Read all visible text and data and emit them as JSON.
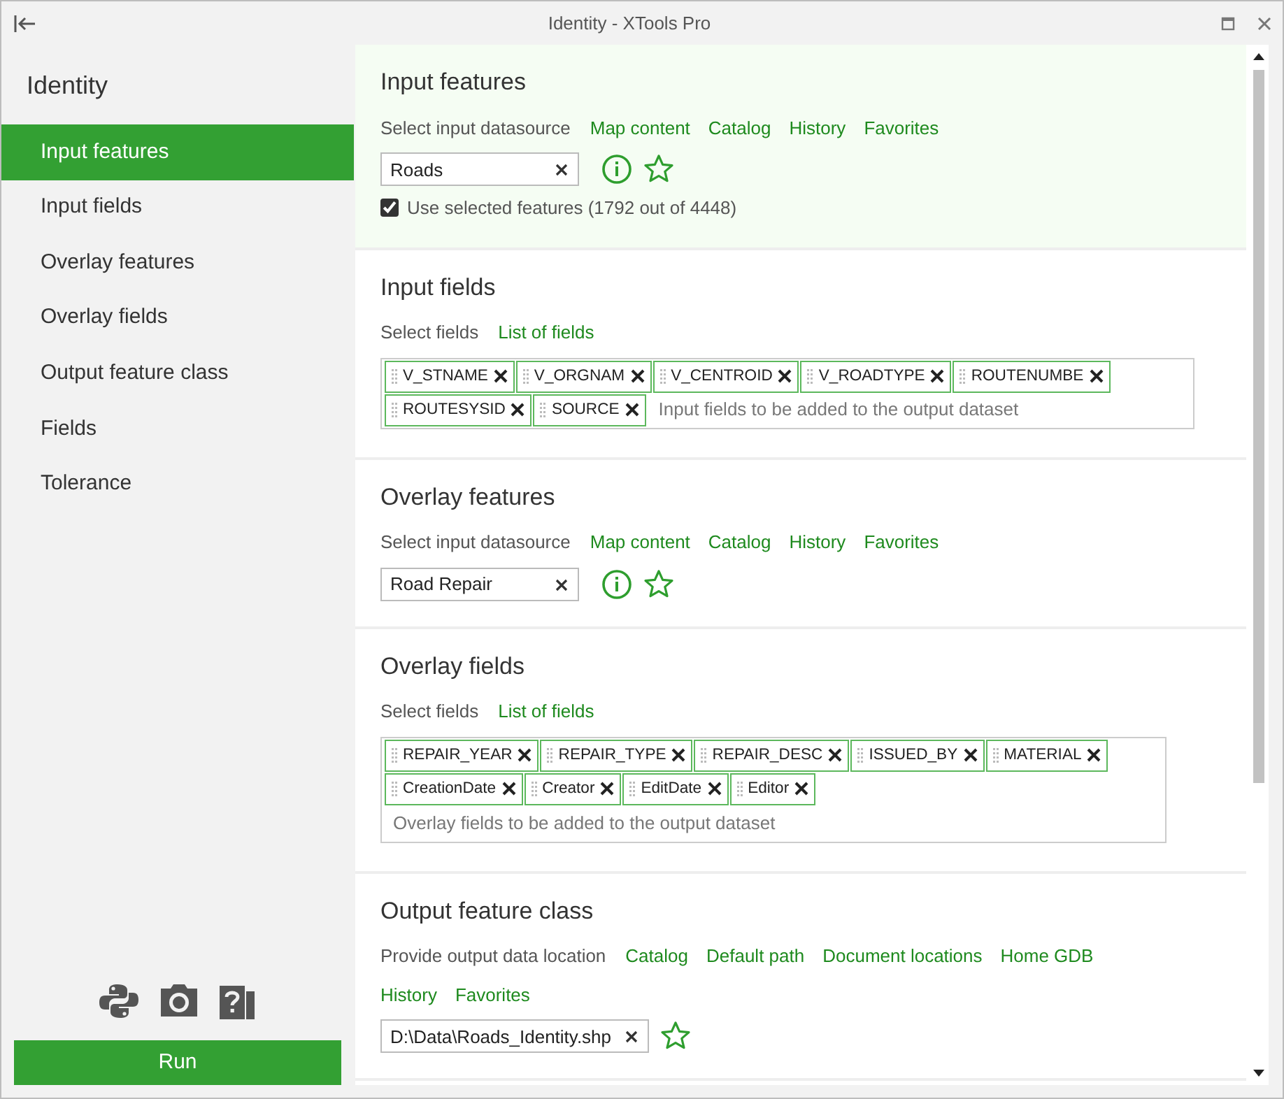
{
  "window": {
    "title": "Identity - XTools Pro"
  },
  "sidebar": {
    "title": "Identity",
    "items": [
      {
        "label": "Input features",
        "selected": true
      },
      {
        "label": "Input fields",
        "selected": false
      },
      {
        "label": "Overlay features",
        "selected": false
      },
      {
        "label": "Overlay fields",
        "selected": false
      },
      {
        "label": "Output feature class",
        "selected": false
      },
      {
        "label": "Fields",
        "selected": false
      },
      {
        "label": "Tolerance",
        "selected": false
      }
    ],
    "run_button": "Run"
  },
  "sections": [
    {
      "kind": "datasource",
      "title": "Input features",
      "selected": true,
      "prompt": "Select input datasource",
      "links": [
        "Map content",
        "Catalog",
        "History",
        "Favorites"
      ],
      "value": "Roads",
      "checkbox": {
        "label": "Use selected features (1792 out of 4448)",
        "checked": true
      }
    },
    {
      "kind": "fields",
      "title": "Input fields",
      "selected": false,
      "prompt": "Select fields",
      "links": [
        "List of fields"
      ],
      "tags": [
        "V_STNAME",
        "V_ORGNAM",
        "V_CENTROID",
        "V_ROADTYPE",
        "ROUTENUMBE",
        "ROUTESYSID",
        "SOURCE"
      ],
      "placeholder": "Input fields to be added to the output dataset"
    },
    {
      "kind": "datasource",
      "title": "Overlay features",
      "selected": false,
      "prompt": "Select input datasource",
      "links": [
        "Map content",
        "Catalog",
        "History",
        "Favorites"
      ],
      "value": "Road Repair"
    },
    {
      "kind": "fields",
      "title": "Overlay fields",
      "selected": false,
      "prompt": "Select fields",
      "links": [
        "List of fields"
      ],
      "tags": [
        "REPAIR_YEAR",
        "REPAIR_TYPE",
        "REPAIR_DESC",
        "ISSUED_BY",
        "MATERIAL",
        "CreationDate",
        "Creator",
        "EditDate",
        "Editor"
      ],
      "placeholder": "Overlay fields to be added to the output dataset"
    },
    {
      "kind": "output",
      "title": "Output feature class",
      "selected": false,
      "prompt": "Provide output data location",
      "links": [
        "Catalog",
        "Default path",
        "Document locations",
        "Home GDB",
        "History",
        "Favorites"
      ],
      "value": "D:\\Data\\Roads_Identity.shp"
    }
  ]
}
